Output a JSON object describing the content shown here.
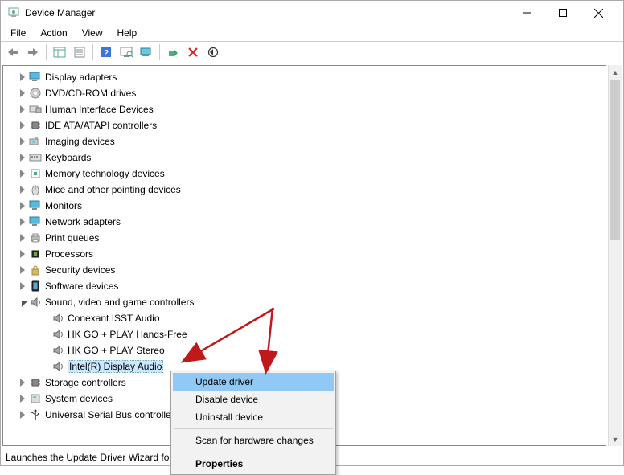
{
  "title": "Device Manager",
  "menus": {
    "file": "File",
    "action": "Action",
    "view": "View",
    "help": "Help"
  },
  "tree": {
    "lvl2": [
      {
        "key": "display_adapters",
        "label": "Display adapters",
        "icon": "monitor"
      },
      {
        "key": "dvd",
        "label": "DVD/CD-ROM drives",
        "icon": "disc"
      },
      {
        "key": "hid",
        "label": "Human Interface Devices",
        "icon": "hid"
      },
      {
        "key": "ide",
        "label": "IDE ATA/ATAPI controllers",
        "icon": "chip"
      },
      {
        "key": "imaging",
        "label": "Imaging devices",
        "icon": "camera"
      },
      {
        "key": "keyboards",
        "label": "Keyboards",
        "icon": "keyboard"
      },
      {
        "key": "memtech",
        "label": "Memory technology devices",
        "icon": "chip2"
      },
      {
        "key": "mice",
        "label": "Mice and other pointing devices",
        "icon": "mouse"
      },
      {
        "key": "monitors",
        "label": "Monitors",
        "icon": "monitor"
      },
      {
        "key": "network",
        "label": "Network adapters",
        "icon": "monitor"
      },
      {
        "key": "printq",
        "label": "Print queues",
        "icon": "printer"
      },
      {
        "key": "processors",
        "label": "Processors",
        "icon": "cpu"
      },
      {
        "key": "security",
        "label": "Security devices",
        "icon": "lock"
      },
      {
        "key": "software",
        "label": "Software devices",
        "icon": "phone"
      }
    ],
    "sound": {
      "label": "Sound, video and game controllers",
      "children": [
        "Conexant ISST Audio",
        "HK GO + PLAY Hands-Free",
        "HK GO + PLAY Stereo",
        "Intel(R) Display Audio"
      ]
    },
    "after": [
      {
        "key": "storage",
        "label": "Storage controllers",
        "icon": "chip"
      },
      {
        "key": "system",
        "label": "System devices",
        "icon": "pc"
      },
      {
        "key": "usb",
        "label": "Universal Serial Bus controllers",
        "icon": "usb"
      }
    ]
  },
  "context_menu": {
    "update": "Update driver",
    "disable": "Disable device",
    "uninstall": "Uninstall device",
    "scan": "Scan for hardware changes",
    "properties": "Properties"
  },
  "status": "Launches the Update Driver Wizard for the selected device.",
  "colors": {
    "accent": "#90c8f6",
    "selection": "#cce8ff",
    "arrow": "#c11919"
  }
}
